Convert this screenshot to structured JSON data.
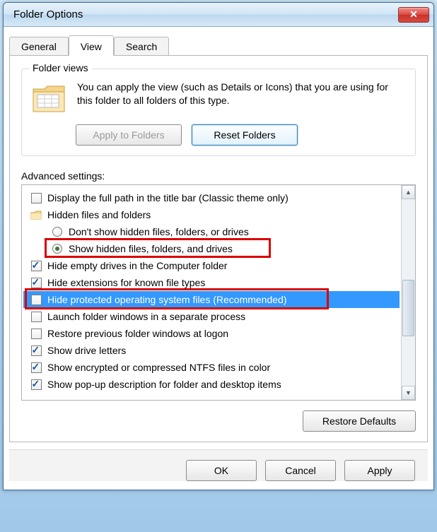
{
  "window": {
    "title": "Folder Options"
  },
  "tabs": [
    {
      "label": "General",
      "active": false
    },
    {
      "label": "View",
      "active": true
    },
    {
      "label": "Search",
      "active": false
    }
  ],
  "folder_views": {
    "legend": "Folder views",
    "description": "You can apply the view (such as Details or Icons) that you are using for this folder to all folders of this type.",
    "apply_btn": "Apply to Folders",
    "reset_btn": "Reset Folders"
  },
  "advanced": {
    "label": "Advanced settings:",
    "restore_btn": "Restore Defaults",
    "items": [
      {
        "type": "checkbox",
        "checked": false,
        "label": "Display the full path in the title bar (Classic theme only)"
      },
      {
        "type": "folder",
        "label": "Hidden files and folders"
      },
      {
        "type": "radio",
        "checked": false,
        "indent": true,
        "label": "Don't show hidden files, folders, or drives"
      },
      {
        "type": "radio",
        "checked": true,
        "indent": true,
        "label": "Show hidden files, folders, and drives",
        "highlight": true
      },
      {
        "type": "checkbox",
        "checked": true,
        "label": "Hide empty drives in the Computer folder"
      },
      {
        "type": "checkbox",
        "checked": true,
        "label": "Hide extensions for known file types"
      },
      {
        "type": "checkbox",
        "checked": false,
        "label": "Hide protected operating system files (Recommended)",
        "highlight": true,
        "selected": true
      },
      {
        "type": "checkbox",
        "checked": false,
        "label": "Launch folder windows in a separate process"
      },
      {
        "type": "checkbox",
        "checked": false,
        "label": "Restore previous folder windows at logon"
      },
      {
        "type": "checkbox",
        "checked": true,
        "label": "Show drive letters"
      },
      {
        "type": "checkbox",
        "checked": true,
        "label": "Show encrypted or compressed NTFS files in color"
      },
      {
        "type": "checkbox",
        "checked": true,
        "label": "Show pop-up description for folder and desktop items"
      }
    ]
  },
  "buttons": {
    "ok": "OK",
    "cancel": "Cancel",
    "apply": "Apply"
  }
}
